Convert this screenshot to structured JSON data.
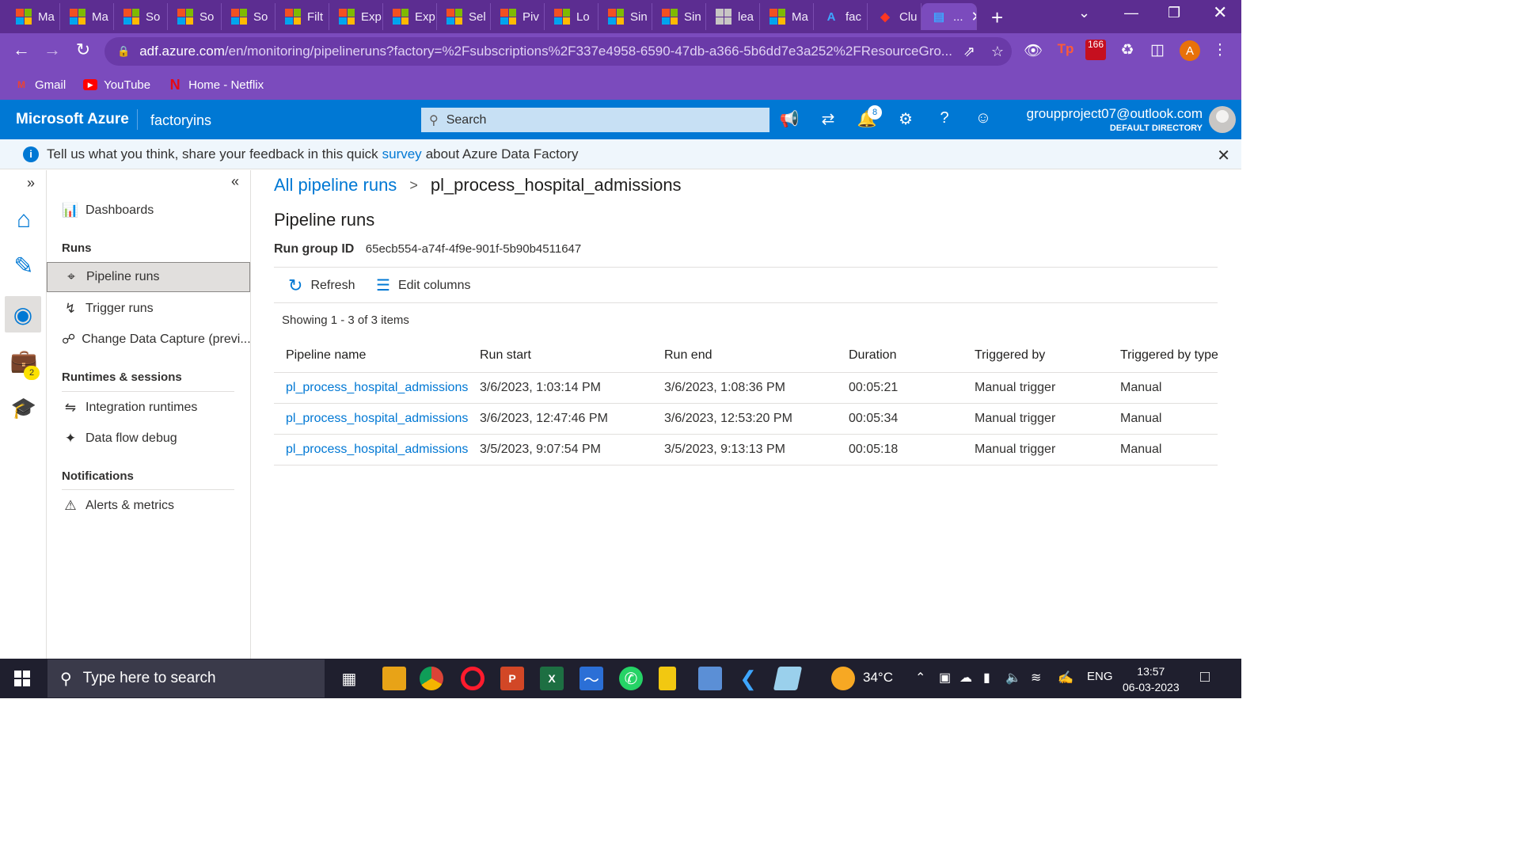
{
  "browser": {
    "tabs": [
      {
        "label": "Ma",
        "fav": "ms"
      },
      {
        "label": "Ma",
        "fav": "ms"
      },
      {
        "label": "So",
        "fav": "ms"
      },
      {
        "label": "So",
        "fav": "ms"
      },
      {
        "label": "So",
        "fav": "ms"
      },
      {
        "label": "Filt",
        "fav": "ms"
      },
      {
        "label": "Exp",
        "fav": "ms"
      },
      {
        "label": "Exp",
        "fav": "ms"
      },
      {
        "label": "Sel",
        "fav": "ms"
      },
      {
        "label": "Piv",
        "fav": "ms"
      },
      {
        "label": "Lo",
        "fav": "ms"
      },
      {
        "label": "Sin",
        "fav": "ms"
      },
      {
        "label": "Sin",
        "fav": "ms"
      },
      {
        "label": "lea",
        "fav": "doc"
      },
      {
        "label": "Ma",
        "fav": "ms"
      },
      {
        "label": "fac",
        "fav": "azure"
      },
      {
        "label": "Clu",
        "fav": "databricks"
      },
      {
        "label": "...",
        "fav": "adf"
      }
    ],
    "url_host": "adf.azure.com",
    "url_rest": "/en/monitoring/pipelineruns?factory=%2Fsubscriptions%2F337e4958-6590-47db-a366-5b6dd7e3a252%2FResourceGro...",
    "extension_badge": "166",
    "profile_initial": "A",
    "bookmarks": [
      {
        "label": "Gmail",
        "icon": "gmail-icon"
      },
      {
        "label": "YouTube",
        "icon": "youtube-icon"
      },
      {
        "label": "Home - Netflix",
        "icon": "netflix-icon"
      }
    ]
  },
  "azure": {
    "brand": "Microsoft Azure",
    "factory": "factoryins",
    "search_placeholder": "Search",
    "notification_count": "8",
    "account_email": "groupproject07@outlook.com",
    "account_directory": "DEFAULT DIRECTORY",
    "accent_color": "#0078d4"
  },
  "banner": {
    "text_before": "Tell us what you think, share your feedback in this quick",
    "link": "survey",
    "text_after": "about Azure Data Factory"
  },
  "rail": {
    "badge": "2"
  },
  "sidebar": {
    "dashboards": "Dashboards",
    "runs_heading": "Runs",
    "pipeline_runs": "Pipeline runs",
    "trigger_runs": "Trigger runs",
    "change_data_capture": "Change Data Capture (previ...",
    "runtimes_heading": "Runtimes & sessions",
    "integration_runtimes": "Integration runtimes",
    "data_flow_debug": "Data flow debug",
    "notifications_heading": "Notifications",
    "alerts_metrics": "Alerts & metrics"
  },
  "main": {
    "breadcrumb_root": "All pipeline runs",
    "breadcrumb_sep": ">",
    "breadcrumb_current": "pl_process_hospital_admissions",
    "title": "Pipeline runs",
    "run_group_label": "Run group ID",
    "run_group_id": "65ecb554-a74f-4f9e-901f-5b90b4511647",
    "refresh_label": "Refresh",
    "edit_columns_label": "Edit columns",
    "showing": "Showing 1 - 3 of 3 items",
    "columns": [
      "Pipeline name",
      "Run start",
      "Run end",
      "Duration",
      "Triggered by",
      "Triggered by type"
    ],
    "rows": [
      [
        "pl_process_hospital_admissions",
        "3/6/2023, 1:03:14 PM",
        "3/6/2023, 1:08:36 PM",
        "00:05:21",
        "Manual trigger",
        "Manual"
      ],
      [
        "pl_process_hospital_admissions",
        "3/6/2023, 12:47:46 PM",
        "3/6/2023, 12:53:20 PM",
        "00:05:34",
        "Manual trigger",
        "Manual"
      ],
      [
        "pl_process_hospital_admissions",
        "3/5/2023, 9:07:54 PM",
        "3/5/2023, 9:13:13 PM",
        "00:05:18",
        "Manual trigger",
        "Manual"
      ]
    ]
  },
  "taskbar": {
    "search_placeholder": "Type here to search",
    "weather": "34°C",
    "language": "ENG",
    "time": "13:57",
    "date": "06-03-2023"
  }
}
